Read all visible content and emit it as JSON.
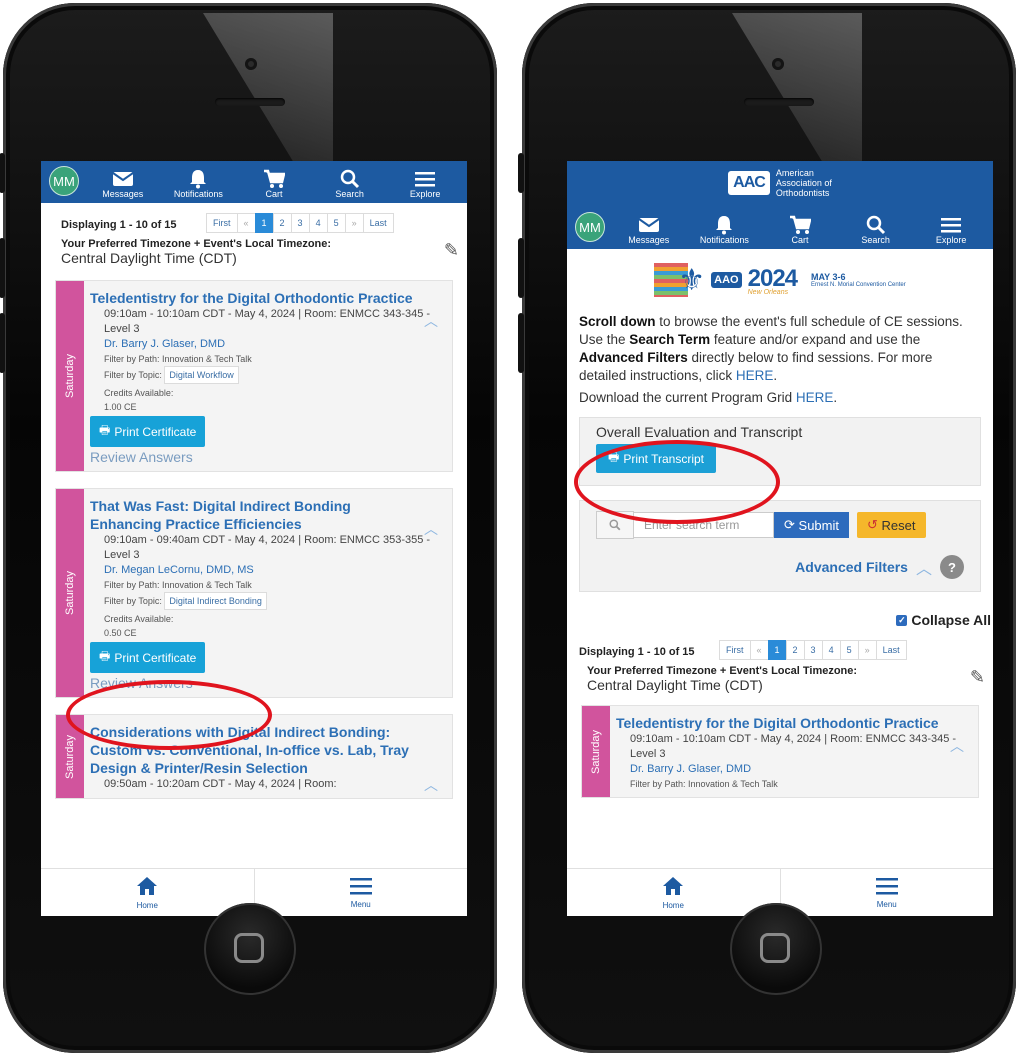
{
  "left_phone": {
    "nav": {
      "avatar": "MM",
      "items": [
        {
          "label": "Messages",
          "icon": "envelope-icon"
        },
        {
          "label": "Notifications",
          "icon": "bell-icon"
        },
        {
          "label": "Cart",
          "icon": "cart-icon"
        },
        {
          "label": "Search",
          "icon": "search-icon"
        },
        {
          "label": "Explore",
          "icon": "menu-icon"
        }
      ]
    },
    "pagination": {
      "info": "Displaying 1 - 10 of 15",
      "first": "First",
      "prev": "«",
      "pages": [
        "1",
        "2",
        "3",
        "4",
        "5"
      ],
      "next": "»",
      "last": "Last"
    },
    "timezone": {
      "heading": "Your Preferred Timezone + Event's Local Timezone:",
      "value": "Central Daylight Time (CDT)"
    },
    "sessions": [
      {
        "day": "Saturday",
        "title": "Teledentistry for the Digital Orthodontic Practice",
        "time": "09:10am - 10:10am CDT - May 4, 2024 | Room: ENMCC 343-345 - Level 3",
        "speaker": "Dr. Barry J. Glaser, DMD",
        "path": "Filter by Path: Innovation & Tech Talk",
        "topic_label": "Filter by Topic:",
        "topic": "Digital Workflow",
        "credits_label": "Credits Available:",
        "credits": "1.00 CE",
        "print": "Print Certificate",
        "review": "Review Answers"
      },
      {
        "day": "Saturday",
        "title": "That Was Fast: Digital Indirect Bonding Enhancing Practice Efficiencies",
        "time": "09:10am - 09:40am CDT - May 4, 2024 | Room: ENMCC 353-355 - Level 3",
        "speaker": "Dr. Megan LeCornu, DMD, MS",
        "path": "Filter by Path: Innovation & Tech Talk",
        "topic_label": "Filter by Topic:",
        "topic": "Digital Indirect Bonding",
        "credits_label": "Credits Available:",
        "credits": "0.50 CE",
        "print": "Print Certificate",
        "review": "Review Answers"
      },
      {
        "day": "Saturday",
        "title": "Considerations with Digital Indirect Bonding: Custom vs. Conventional, In-office vs. Lab, Tray Design & Printer/Resin Selection",
        "time": "09:50am - 10:20am CDT - May 4, 2024 | Room:"
      }
    ],
    "footer": {
      "home": "Home",
      "menu": "Menu"
    }
  },
  "right_phone": {
    "brand": {
      "logo": "AAC",
      "line1": "American",
      "line2": "Association of",
      "line3": "Orthodontists"
    },
    "nav": {
      "avatar": "MM",
      "items": [
        {
          "label": "Messages",
          "icon": "envelope-icon"
        },
        {
          "label": "Notifications",
          "icon": "bell-icon"
        },
        {
          "label": "Cart",
          "icon": "cart-icon"
        },
        {
          "label": "Search",
          "icon": "search-icon"
        },
        {
          "label": "Explore",
          "icon": "menu-icon"
        }
      ]
    },
    "banner": {
      "logo": "AAO",
      "year": "2024",
      "city": "New Orleans",
      "dates": "MAY 3-6",
      "venue": "Ernest N. Morial Convention Center"
    },
    "intro": {
      "p1_b1": "Scroll down",
      "p1_t1": " to browse the event's full schedule of CE sessions. Use the ",
      "p1_b2": "Search Term",
      "p1_t2": " feature and/or expand and use the ",
      "p1_b3": "Advanced Filters",
      "p1_t3": " directly below to find sessions. For more detailed instructions, click ",
      "p1_link": "HERE",
      "p1_end": ".",
      "p2_text": "Download the current Program Grid ",
      "p2_link": "HERE",
      "p2_end": "."
    },
    "evaluation": {
      "heading": "Overall Evaluation and Transcript",
      "button": "Print Transcript"
    },
    "search": {
      "placeholder": "Enter search term",
      "submit": "Submit",
      "reset": "Reset",
      "advanced": "Advanced Filters",
      "help": "?"
    },
    "collapse_all": "Collapse All",
    "pagination": {
      "info": "Displaying 1 - 10 of 15",
      "first": "First",
      "prev": "«",
      "pages": [
        "1",
        "2",
        "3",
        "4",
        "5"
      ],
      "next": "»",
      "last": "Last"
    },
    "timezone": {
      "heading": "Your Preferred Timezone + Event's Local Timezone:",
      "value": "Central Daylight Time (CDT)"
    },
    "session": {
      "day": "Saturday",
      "title": "Teledentistry for the Digital Orthodontic Practice",
      "time": "09:10am - 10:10am CDT - May 4, 2024 | Room: ENMCC 343-345 - Level 3",
      "speaker": "Dr. Barry J. Glaser, DMD",
      "path": "Filter by Path: Innovation & Tech Talk"
    },
    "footer": {
      "home": "Home",
      "menu": "Menu"
    }
  },
  "colors": {
    "brand": "#1d5aa1",
    "accent": "#17a2d8",
    "day": "#d1549d",
    "highlight": "#e0141e",
    "reset": "#f5b72b"
  }
}
